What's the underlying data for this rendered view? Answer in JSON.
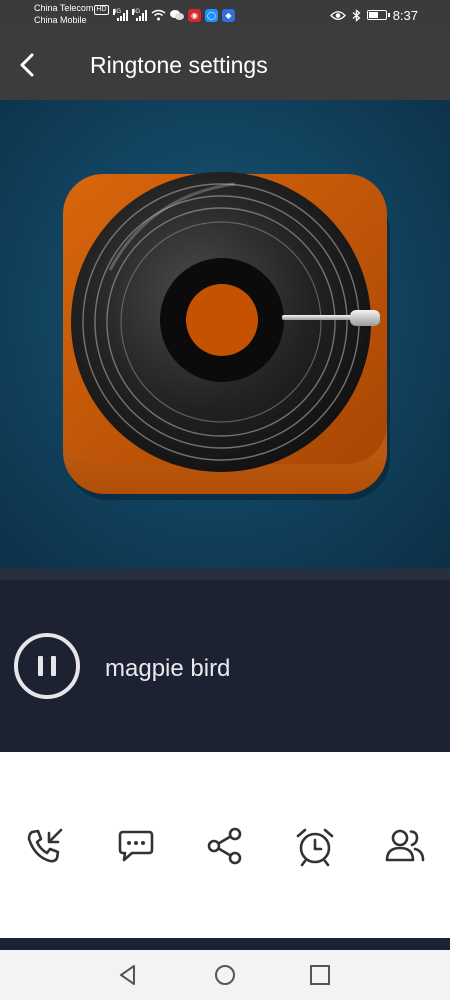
{
  "status_bar": {
    "carrier_1": "China Telecom",
    "carrier_1_badge": "HD",
    "carrier_2": "China Mobile",
    "network_1": "4G",
    "network_2": "4G",
    "time": "8:37"
  },
  "header": {
    "title": "Ringtone settings",
    "back_icon": "chevron-left-icon"
  },
  "artwork": {
    "icon": "vinyl-record-turntable-icon",
    "colors": {
      "background": "#124562",
      "case": "#c3580a",
      "record": "#202020",
      "label": "#c45200"
    }
  },
  "player": {
    "song_name": "magpie bird",
    "state_icon": "pause-icon"
  },
  "actions": [
    {
      "icon": "incoming-call-icon"
    },
    {
      "icon": "message-bubble-icon"
    },
    {
      "icon": "share-icon"
    },
    {
      "icon": "alarm-clock-icon"
    },
    {
      "icon": "contacts-icon"
    }
  ],
  "navigation": [
    "back-triangle-icon",
    "home-circle-icon",
    "recents-square-icon"
  ]
}
